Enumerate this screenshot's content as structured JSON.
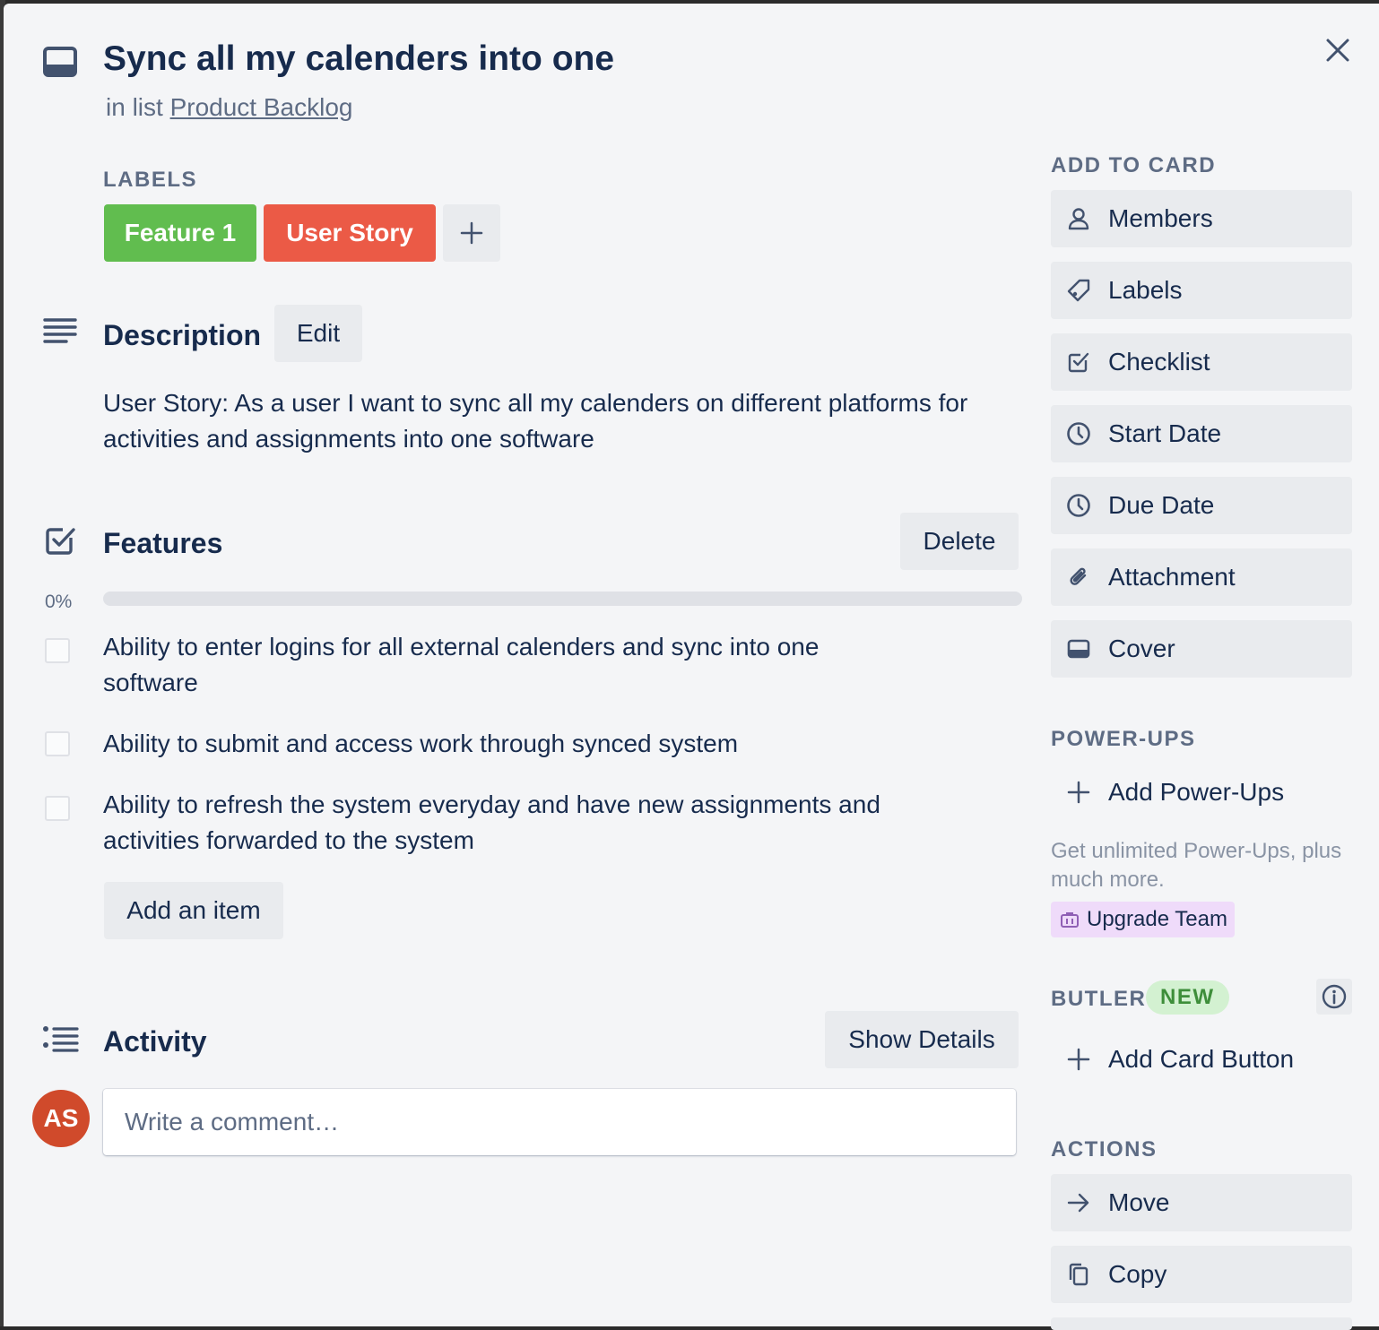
{
  "card": {
    "title": "Sync all my calenders into one",
    "subtitle_prefix": "in list",
    "list_name": "Product Backlog",
    "close_icon": "close-icon",
    "card_icon": "card-icon"
  },
  "labels": {
    "heading": "LABELS",
    "items": [
      {
        "text": "Feature 1",
        "color": "#61bd4f"
      },
      {
        "text": "User Story",
        "color": "#eb5a46"
      }
    ],
    "add_symbol": "+"
  },
  "description": {
    "heading": "Description",
    "edit_label": "Edit",
    "text": "User Story: As a user I want to sync all my calenders on different platforms for activities and assignments into one software"
  },
  "checklist": {
    "heading": "Features",
    "delete_label": "Delete",
    "progress_text": "0%",
    "progress_fraction": 0,
    "items": [
      {
        "text": "Ability to enter logins for all external calenders and sync into one software",
        "checked": false
      },
      {
        "text": "Ability to submit and access work through synced system",
        "checked": false
      },
      {
        "text": "Ability to refresh the system everyday and have new assignments and activities forwarded to the system",
        "checked": false
      }
    ],
    "add_item_label": "Add an item"
  },
  "activity": {
    "heading": "Activity",
    "show_details_label": "Show Details",
    "avatar_initials": "AS",
    "comment_placeholder": "Write a comment…"
  },
  "sidebar": {
    "add_to_card_heading": "ADD TO CARD",
    "add_to_card": [
      {
        "label": "Members",
        "icon": "person-icon"
      },
      {
        "label": "Labels",
        "icon": "tag-icon"
      },
      {
        "label": "Checklist",
        "icon": "checklist-icon"
      },
      {
        "label": "Start Date",
        "icon": "clock-icon"
      },
      {
        "label": "Due Date",
        "icon": "clock-icon"
      },
      {
        "label": "Attachment",
        "icon": "paperclip-icon"
      },
      {
        "label": "Cover",
        "icon": "cover-icon"
      }
    ],
    "powerups_heading": "POWER-UPS",
    "add_powerups_label": "Add Power-Ups",
    "powerups_promo": "Get unlimited Power-Ups, plus much more.",
    "upgrade_label": "Upgrade Team",
    "butler_heading": "BUTLER",
    "butler_badge": "NEW",
    "add_card_button_label": "Add Card Button",
    "actions_heading": "ACTIONS",
    "actions": [
      {
        "label": "Move",
        "icon": "arrow-right-icon"
      },
      {
        "label": "Copy",
        "icon": "copy-icon"
      }
    ]
  }
}
